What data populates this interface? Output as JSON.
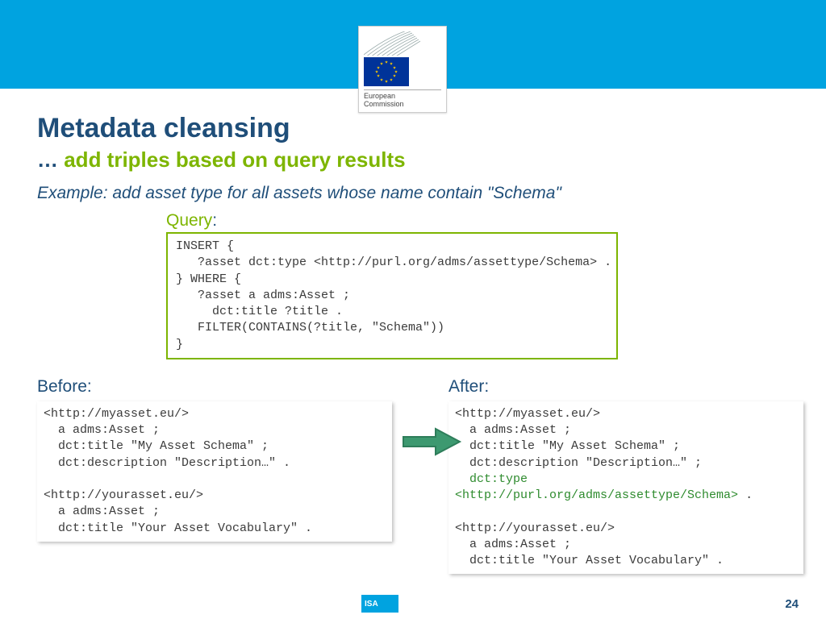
{
  "logo": {
    "line1": "European",
    "line2": "Commission"
  },
  "title": "Metadata cleansing",
  "subtitle_dots": "…",
  "subtitle_rest": " add triples based on query results",
  "example": "Example: add asset type for all assets whose name contain \"Schema\"",
  "query_label_q": "Query",
  "query_label_c": ":",
  "query_code": "INSERT {\n   ?asset dct:type <http://purl.org/adms/assettype/Schema> .\n} WHERE {\n   ?asset a adms:Asset ;\n     dct:title ?title .\n   FILTER(CONTAINS(?title, \"Schema\"))\n}",
  "before_label": "Before:",
  "after_label": "After:",
  "before_code": "<http://myasset.eu/>\n  a adms:Asset ;\n  dct:title \"My Asset Schema\" ;\n  dct:description \"Description…\" .\n\n<http://yourasset.eu/>\n  a adms:Asset ;\n  dct:title \"Your Asset Vocabulary\" .",
  "after_pre1": "<http://myasset.eu/>\n  a adms:Asset ;\n  dct:title \"My Asset Schema\" ;\n  dct:description \"Description…\" ;\n  ",
  "after_hl1": "dct:type",
  "after_nl": "\n",
  "after_hl2": "<http://purl.org/adms/assettype/Schema>",
  "after_post": " .\n\n<http://yourasset.eu/>\n  a adms:Asset ;\n  dct:title \"Your Asset Vocabulary\" .",
  "isa": "ISA",
  "page": "24"
}
